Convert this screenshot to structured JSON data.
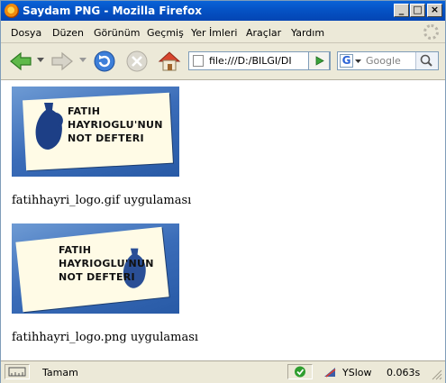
{
  "window": {
    "title": "Saydam PNG - Mozilla Firefox",
    "controls": {
      "minimize": "_",
      "maximize": "□",
      "close": "×"
    }
  },
  "menu": [
    "Dosya",
    "Düzen",
    "Görünüm",
    "Geçmiş",
    "Yer İmleri",
    "Araçlar",
    "Yardım"
  ],
  "toolbar": {
    "url": "file:///D:/BILGI/DI",
    "search_placeholder": "Google"
  },
  "content": {
    "logo_text": [
      "FATIH",
      "HAYRIOGLU'NUN",
      "NOT DEFTERI"
    ],
    "caption1": "fatihhayri_logo.gif uygulaması",
    "caption2": "fatihhayri_logo.png uygulaması"
  },
  "status": {
    "text": "Tamam",
    "yslow": "YSlow",
    "time": "0.063s"
  }
}
